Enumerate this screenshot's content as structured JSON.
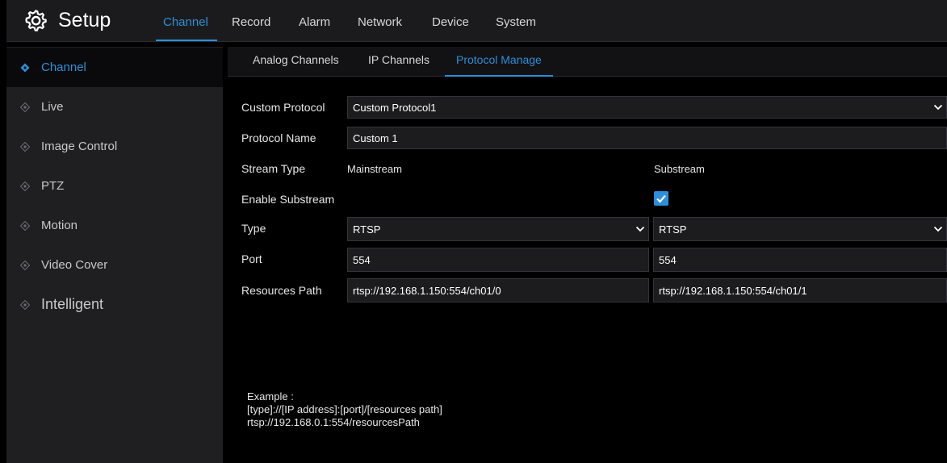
{
  "header": {
    "title": "Setup",
    "gear_icon": "gear-icon",
    "tabs": [
      {
        "label": "Channel",
        "active": true
      },
      {
        "label": "Record"
      },
      {
        "label": "Alarm"
      },
      {
        "label": "Network"
      },
      {
        "label": "Device"
      },
      {
        "label": "System"
      }
    ]
  },
  "sidebar": {
    "items": [
      {
        "label": "Channel",
        "active": true
      },
      {
        "label": "Live"
      },
      {
        "label": "Image Control"
      },
      {
        "label": "PTZ"
      },
      {
        "label": "Motion"
      },
      {
        "label": "Video Cover"
      },
      {
        "label": "Intelligent"
      }
    ]
  },
  "subtabs": [
    {
      "label": "Analog Channels"
    },
    {
      "label": "IP Channels"
    },
    {
      "label": "Protocol Manage",
      "active": true
    }
  ],
  "form": {
    "custom_protocol_label": "Custom Protocol",
    "custom_protocol_value": "Custom Protocol1",
    "protocol_name_label": "Protocol Name",
    "protocol_name_value": "Custom 1",
    "stream_type_label": "Stream Type",
    "mainstream_label": "Mainstream",
    "substream_label": "Substream",
    "enable_substream_label": "Enable Substream",
    "enable_substream_checked": true,
    "type_label": "Type",
    "main_type": "RTSP",
    "sub_type": "RTSP",
    "port_label": "Port",
    "main_port": "554",
    "sub_port": "554",
    "resources_path_label": "Resources Path",
    "main_path": "rtsp://192.168.1.150:554/ch01/0",
    "sub_path": "rtsp://192.168.1.150:554/ch01/1"
  },
  "example": {
    "line1": "Example :",
    "line2": "[type]://[IP address]:[port]/[resources path]",
    "line3": "rtsp://192.168.0.1:554/resourcesPath"
  },
  "colors": {
    "accent": "#2e8fd8",
    "sidebar_bg": "#1f1f22",
    "topbar_bg": "#1b1b1d",
    "field_bg": "#1c1c1e"
  }
}
